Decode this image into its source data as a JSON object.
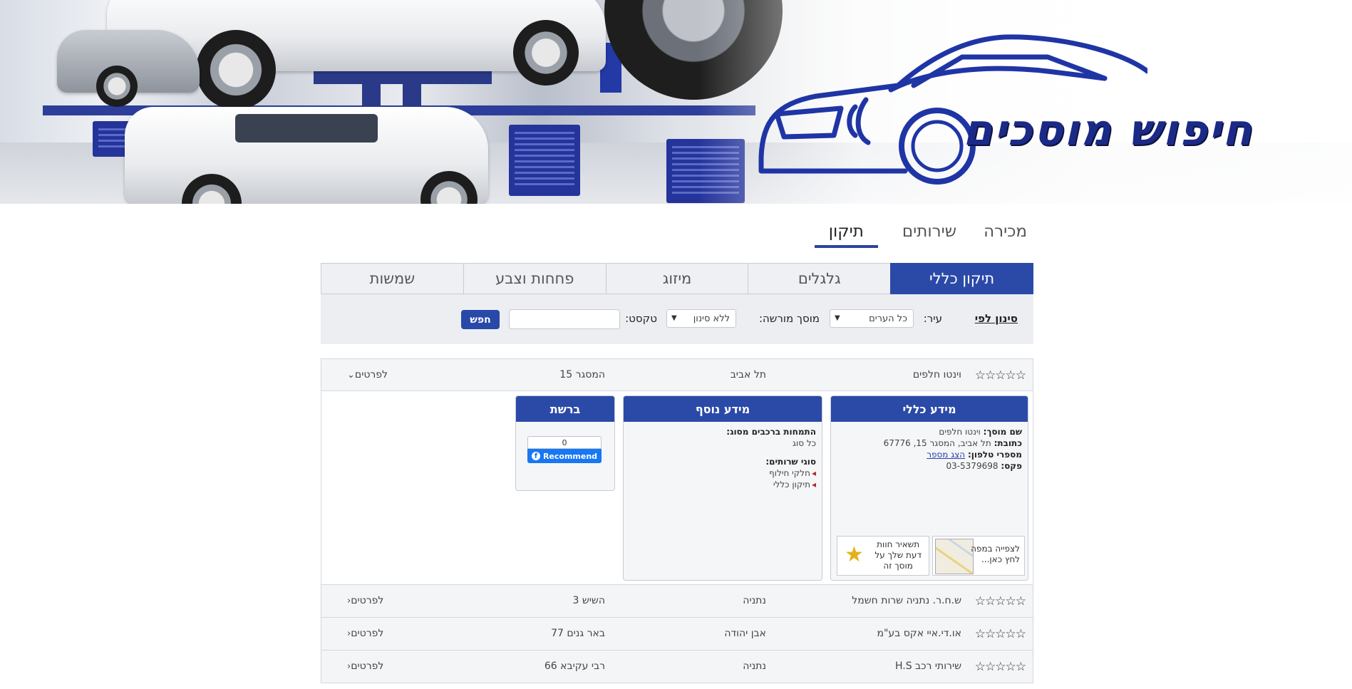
{
  "header": {
    "logo_text": "חיפוש מוסכים"
  },
  "top_tabs": [
    "תיקון",
    "שירותים",
    "מכירה"
  ],
  "categories": [
    "תיקון כללי",
    "גלגלים",
    "מיזוג",
    "פחחות וצבע",
    "שמשות"
  ],
  "filter": {
    "title": "סינון לפי",
    "city_label": "עיר:",
    "city_value": "כל הערים",
    "authorized_label": "מוסך מורשה:",
    "authorized_value": "ללא סינון",
    "text_label": "טקסט:",
    "text_value": "",
    "search_button": "חפש"
  },
  "results": [
    {
      "stars": "☆☆☆☆☆",
      "name": "וינטו חלפים",
      "city": "תל אביב",
      "address": "המסגר 15",
      "details": "לפרטים"
    },
    {
      "stars": "☆☆☆☆☆",
      "name": "ש.ח.ר. נתניה שרות חשמל",
      "city": "נתניה",
      "address": "השיש 3",
      "details": "לפרטים"
    },
    {
      "stars": "☆☆☆☆☆",
      "name": "או.די.איי אקס בע\"מ",
      "city": "אבן יהודה",
      "address": "באר גנים 77",
      "details": "לפרטים"
    },
    {
      "stars": "☆☆☆☆☆",
      "name": "שירותי רכב H.S",
      "city": "נתניה",
      "address": "רבי עקיבא 66",
      "details": "לפרטים"
    }
  ],
  "detail": {
    "general_title": "מידע כללי",
    "name_label": "שם מוסך:",
    "name_value": "וינטו חלפים",
    "address_label": "כתובת:",
    "address_value": "תל אביב, המסגר 15, 67776",
    "phone_label": "מספרי טלפון:",
    "phone_link": "הצג מספר",
    "fax_label": "פקס:",
    "fax_value": "03-5379698",
    "map_link_line1": "לצפייה במפה",
    "map_link_line2": "לחץ כאן...",
    "review_line1": "תשאיר חוות",
    "review_line2": "דעת שלך על",
    "review_line3": "מוסך זה",
    "extra_title": "מידע נוסף",
    "specialty_label": "התמחות ברכבים מסוג:",
    "specialty_value": "כל סוג",
    "services_label": "סוגי שרותים:",
    "services": [
      "חלקי חילוף",
      "תיקון כללי"
    ],
    "web_title": "ברשת",
    "fb_count": "0",
    "fb_button": "Recommend"
  }
}
